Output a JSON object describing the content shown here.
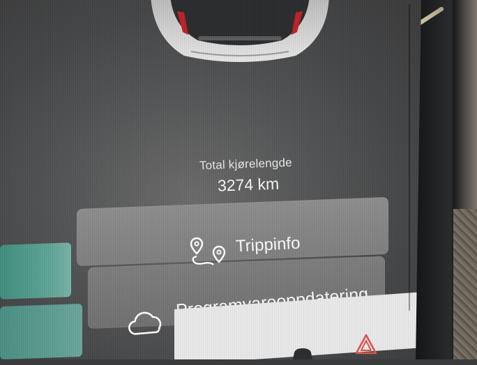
{
  "mileage": {
    "label": "Total kjørelengde",
    "value": "3274 km"
  },
  "buttons": {
    "trip_label": "Trippinfo",
    "update_label": "Programvareoppdatering"
  },
  "icons": {
    "trip": "route-pin-icon",
    "update": "cloud-icon",
    "hazard": "hazard-warning-icon",
    "car": "car-icon"
  },
  "colors": {
    "tile_accent": "#5fa596",
    "hazard": "#d9534f"
  }
}
